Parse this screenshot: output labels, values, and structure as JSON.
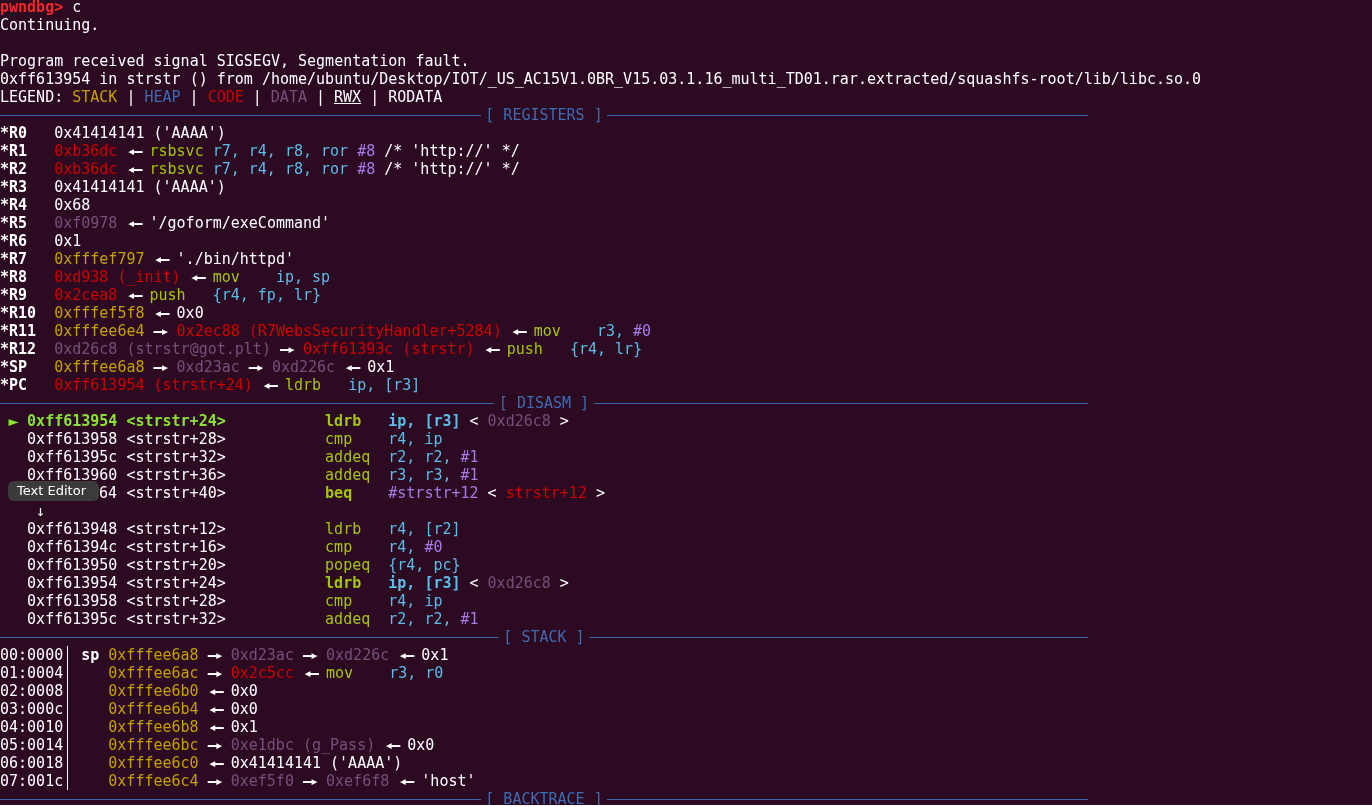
{
  "lines": [
    {
      "kind": "text",
      "segments": [
        {
          "text": "pwndbg>",
          "kind": "prompt"
        },
        {
          "text": "c",
          "kind": "plain"
        }
      ]
    },
    {
      "kind": "text",
      "segments": [
        {
          "text": "Continuing.",
          "kind": "plain"
        }
      ]
    },
    {
      "kind": "blank"
    },
    {
      "kind": "text",
      "segments": [
        {
          "text": "Program received signal SIGSEGV, Segmentation fault.",
          "kind": "plain"
        }
      ]
    },
    {
      "kind": "text",
      "segments": [
        {
          "text": "0xff613954 in strstr () from /home/ubuntu/Desktop/IOT/_US_AC15V1.0BR_V15.03.1.16_multi_TD01.rar.extracted/squashfs-root/lib/libc.so.0",
          "kind": "plain"
        }
      ]
    },
    {
      "kind": "text",
      "segments": [
        {
          "text": "LEGEND:",
          "kind": "plain"
        },
        {
          "text": "STACK",
          "kind": "stack"
        },
        {
          "text": "|",
          "kind": "plain"
        },
        {
          "text": "HEAP",
          "kind": "heap"
        },
        {
          "text": "|",
          "kind": "plain"
        },
        {
          "text": "CODE",
          "kind": "code"
        },
        {
          "text": "|",
          "kind": "plain"
        },
        {
          "text": "DATA",
          "kind": "data"
        },
        {
          "text": "|",
          "kind": "plain"
        },
        {
          "text": "RWX",
          "kind": "rwx"
        },
        {
          "text": "|",
          "kind": "plain"
        },
        {
          "text": "RODATA",
          "kind": "plain"
        }
      ]
    },
    {
      "kind": "rule",
      "title": "[ REGISTERS ]"
    },
    {
      "kind": "reg",
      "name": "*R0",
      "segments": [
        {
          "text": "0x41414141 ('AAAA')",
          "kind": "plain"
        }
      ]
    },
    {
      "kind": "reg",
      "name": "*R1",
      "segments": [
        {
          "text": "0xb36dc",
          "kind": "code"
        },
        {
          "text": "◂—",
          "kind": "arrow"
        },
        {
          "text": "rsbsvc",
          "kind": "insn"
        },
        {
          "text": "r7, r4, r8, ror",
          "kind": "reg"
        },
        {
          "text": "#8",
          "kind": "imm"
        },
        {
          "text": "/* 'http://' */",
          "kind": "plain"
        }
      ]
    },
    {
      "kind": "reg",
      "name": "*R2",
      "segments": [
        {
          "text": "0xb36dc",
          "kind": "code"
        },
        {
          "text": "◂—",
          "kind": "arrow"
        },
        {
          "text": "rsbsvc",
          "kind": "insn"
        },
        {
          "text": "r7, r4, r8, ror",
          "kind": "reg"
        },
        {
          "text": "#8",
          "kind": "imm"
        },
        {
          "text": "/* 'http://' */",
          "kind": "plain"
        }
      ]
    },
    {
      "kind": "reg",
      "name": "*R3",
      "segments": [
        {
          "text": "0x41414141 ('AAAA')",
          "kind": "plain"
        }
      ]
    },
    {
      "kind": "reg",
      "name": "*R4",
      "segments": [
        {
          "text": "0x68",
          "kind": "plain"
        }
      ]
    },
    {
      "kind": "reg",
      "name": "*R5",
      "segments": [
        {
          "text": "0xf0978",
          "kind": "data"
        },
        {
          "text": "◂—",
          "kind": "arrow"
        },
        {
          "text": "'/goform/exeCommand'",
          "kind": "plain"
        }
      ]
    },
    {
      "kind": "reg",
      "name": "*R6",
      "segments": [
        {
          "text": "0x1",
          "kind": "plain"
        }
      ]
    },
    {
      "kind": "reg",
      "name": "*R7",
      "segments": [
        {
          "text": "0xfffef797",
          "kind": "stack"
        },
        {
          "text": "◂—",
          "kind": "arrow"
        },
        {
          "text": "'./bin/httpd'",
          "kind": "plain"
        }
      ]
    },
    {
      "kind": "reg",
      "name": "*R8",
      "segments": [
        {
          "text": "0xd938 (_init)",
          "kind": "code"
        },
        {
          "text": "◂—",
          "kind": "arrow"
        },
        {
          "text": "mov",
          "kind": "insn"
        },
        {
          "text": "ip, sp",
          "kind": "reg"
        }
      ]
    },
    {
      "kind": "reg",
      "name": "*R9",
      "segments": [
        {
          "text": "0x2cea8",
          "kind": "code"
        },
        {
          "text": "◂—",
          "kind": "arrow"
        },
        {
          "text": "push",
          "kind": "insn"
        },
        {
          "text": "{r4, fp, lr}",
          "kind": "reg"
        }
      ]
    },
    {
      "kind": "reg",
      "name": "*R10",
      "segments": [
        {
          "text": "0xfffef5f8",
          "kind": "stack"
        },
        {
          "text": "◂—",
          "kind": "arrow"
        },
        {
          "text": "0x0",
          "kind": "plain"
        }
      ]
    },
    {
      "kind": "reg",
      "name": "*R11",
      "segments": [
        {
          "text": "0xfffee6e4",
          "kind": "stack"
        },
        {
          "text": "—▸",
          "kind": "arrow"
        },
        {
          "text": "0x2ec88 (R7WebsSecurityHandler+5284)",
          "kind": "code"
        },
        {
          "text": "◂—",
          "kind": "arrow"
        },
        {
          "text": "mov",
          "kind": "insn"
        },
        {
          "text": "r3,",
          "kind": "reg"
        },
        {
          "text": "#0",
          "kind": "imm"
        }
      ]
    },
    {
      "kind": "reg",
      "name": "*R12",
      "segments": [
        {
          "text": "0xd26c8 (strstr@got.plt)",
          "kind": "data"
        },
        {
          "text": "—▸",
          "kind": "arrow"
        },
        {
          "text": "0xff61393c (strstr)",
          "kind": "code"
        },
        {
          "text": "◂—",
          "kind": "arrow"
        },
        {
          "text": "push",
          "kind": "insn"
        },
        {
          "text": "{r4, lr}",
          "kind": "reg"
        }
      ]
    },
    {
      "kind": "reg",
      "name": "*SP",
      "segments": [
        {
          "text": "0xfffee6a8",
          "kind": "stack"
        },
        {
          "text": "—▸",
          "kind": "arrow"
        },
        {
          "text": "0xd23ac",
          "kind": "data"
        },
        {
          "text": "—▸",
          "kind": "arrow"
        },
        {
          "text": "0xd226c",
          "kind": "data"
        },
        {
          "text": "◂—",
          "kind": "arrow"
        },
        {
          "text": "0x1",
          "kind": "plain"
        }
      ]
    },
    {
      "kind": "reg",
      "name": "*PC",
      "segments": [
        {
          "text": "0xff613954 (strstr+24)",
          "kind": "code"
        },
        {
          "text": "◂—",
          "kind": "arrow"
        },
        {
          "text": "ldrb",
          "kind": "insn"
        },
        {
          "text": "ip, [r3]",
          "kind": "reg"
        }
      ]
    },
    {
      "kind": "rule",
      "title": "[ DISASM ]"
    },
    {
      "kind": "disasm",
      "current": true,
      "marker": "►",
      "address": "0xff613954",
      "symbol": "<strstr+24>",
      "mnemonic": "ldrb",
      "bold": true,
      "operands": [
        {
          "text": "ip, [r3]",
          "kind": "reg"
        },
        {
          "text": "<",
          "kind": "plain"
        },
        {
          "text": "0xd26c8",
          "kind": "data"
        },
        {
          "text": ">",
          "kind": "plain"
        }
      ]
    },
    {
      "kind": "disasm",
      "current": false,
      "address": "0xff613958",
      "symbol": "<strstr+28>",
      "mnemonic": "cmp",
      "bold": false,
      "operands": [
        {
          "text": "r4, ip",
          "kind": "reg"
        }
      ]
    },
    {
      "kind": "disasm",
      "current": false,
      "address": "0xff61395c",
      "symbol": "<strstr+32>",
      "mnemonic": "addeq",
      "bold": false,
      "operands": [
        {
          "text": "r2, r2,",
          "kind": "reg"
        },
        {
          "text": "#1",
          "kind": "imm"
        }
      ]
    },
    {
      "kind": "disasm",
      "current": false,
      "address": "0xff613960",
      "symbol": "<strstr+36>",
      "mnemonic": "addeq",
      "bold": false,
      "operands": [
        {
          "text": "r3, r3,",
          "kind": "reg"
        },
        {
          "text": "#1",
          "kind": "imm"
        }
      ]
    },
    {
      "kind": "disasm",
      "current": false,
      "tooltip": "Text Editor",
      "address": "64",
      "symbol": "<strstr+40>",
      "mnemonic": "beq",
      "bold": true,
      "operands": [
        {
          "text": "#strstr+12",
          "kind": "imm"
        },
        {
          "text": "<",
          "kind": "plain"
        },
        {
          "text": "strstr+12",
          "kind": "code"
        },
        {
          "text": ">",
          "kind": "plain"
        }
      ]
    },
    {
      "kind": "jump",
      "arrow": "↓"
    },
    {
      "kind": "disasm",
      "current": false,
      "address": "0xff613948",
      "symbol": "<strstr+12>",
      "mnemonic": "ldrb",
      "bold": false,
      "operands": [
        {
          "text": "r4, [r2]",
          "kind": "reg"
        }
      ]
    },
    {
      "kind": "disasm",
      "current": false,
      "address": "0xff61394c",
      "symbol": "<strstr+16>",
      "mnemonic": "cmp",
      "bold": false,
      "operands": [
        {
          "text": "r4,",
          "kind": "reg"
        },
        {
          "text": "#0",
          "kind": "imm"
        }
      ]
    },
    {
      "kind": "disasm",
      "current": false,
      "address": "0xff613950",
      "symbol": "<strstr+20>",
      "mnemonic": "popeq",
      "bold": false,
      "operands": [
        {
          "text": "{r4, pc}",
          "kind": "reg"
        }
      ]
    },
    {
      "kind": "disasm",
      "current": false,
      "address": "0xff613954",
      "symbol": "<strstr+24>",
      "mnemonic": "ldrb",
      "bold": true,
      "operands": [
        {
          "text": "ip, [r3]",
          "kind": "reg"
        },
        {
          "text": "<",
          "kind": "plain"
        },
        {
          "text": "0xd26c8",
          "kind": "data"
        },
        {
          "text": ">",
          "kind": "plain"
        }
      ]
    },
    {
      "kind": "disasm",
      "current": false,
      "address": "0xff613958",
      "symbol": "<strstr+28>",
      "mnemonic": "cmp",
      "bold": false,
      "operands": [
        {
          "text": "r4, ip",
          "kind": "reg"
        }
      ]
    },
    {
      "kind": "disasm",
      "current": false,
      "address": "0xff61395c",
      "symbol": "<strstr+32>",
      "mnemonic": "addeq",
      "bold": false,
      "operands": [
        {
          "text": "r2, r2,",
          "kind": "reg"
        },
        {
          "text": "#1",
          "kind": "imm"
        }
      ]
    },
    {
      "kind": "rule",
      "title": "[ STACK ]"
    },
    {
      "kind": "stack",
      "offset": "00:0000",
      "pointer": "sp",
      "segments": [
        {
          "text": "0xfffee6a8",
          "kind": "stack"
        },
        {
          "text": "—▸",
          "kind": "arrow"
        },
        {
          "text": "0xd23ac",
          "kind": "data"
        },
        {
          "text": "—▸",
          "kind": "arrow"
        },
        {
          "text": "0xd226c",
          "kind": "data"
        },
        {
          "text": "◂—",
          "kind": "arrow"
        },
        {
          "text": "0x1",
          "kind": "plain"
        }
      ]
    },
    {
      "kind": "stack",
      "offset": "01:0004",
      "segments": [
        {
          "text": "0xfffee6ac",
          "kind": "stack"
        },
        {
          "text": "—▸",
          "kind": "arrow"
        },
        {
          "text": "0x2c5cc",
          "kind": "code"
        },
        {
          "text": "◂—",
          "kind": "arrow"
        },
        {
          "text": "mov",
          "kind": "insn"
        },
        {
          "text": "r3, r0",
          "kind": "reg"
        }
      ]
    },
    {
      "kind": "stack",
      "offset": "02:0008",
      "segments": [
        {
          "text": "0xfffee6b0",
          "kind": "stack"
        },
        {
          "text": "◂—",
          "kind": "arrow"
        },
        {
          "text": "0x0",
          "kind": "plain"
        }
      ]
    },
    {
      "kind": "stack",
      "offset": "03:000c",
      "segments": [
        {
          "text": "0xfffee6b4",
          "kind": "stack"
        },
        {
          "text": "◂—",
          "kind": "arrow"
        },
        {
          "text": "0x0",
          "kind": "plain"
        }
      ]
    },
    {
      "kind": "stack",
      "offset": "04:0010",
      "segments": [
        {
          "text": "0xfffee6b8",
          "kind": "stack"
        },
        {
          "text": "◂—",
          "kind": "arrow"
        },
        {
          "text": "0x1",
          "kind": "plain"
        }
      ]
    },
    {
      "kind": "stack",
      "offset": "05:0014",
      "segments": [
        {
          "text": "0xfffee6bc",
          "kind": "stack"
        },
        {
          "text": "—▸",
          "kind": "arrow"
        },
        {
          "text": "0xe1dbc (g_Pass)",
          "kind": "data"
        },
        {
          "text": "◂—",
          "kind": "arrow"
        },
        {
          "text": "0x0",
          "kind": "plain"
        }
      ]
    },
    {
      "kind": "stack",
      "offset": "06:0018",
      "segments": [
        {
          "text": "0xfffee6c0",
          "kind": "stack"
        },
        {
          "text": "◂—",
          "kind": "arrow"
        },
        {
          "text": "0x41414141 ('AAAA')",
          "kind": "plain"
        }
      ]
    },
    {
      "kind": "stack",
      "offset": "07:001c",
      "segments": [
        {
          "text": "0xfffee6c4",
          "kind": "stack"
        },
        {
          "text": "—▸",
          "kind": "arrow"
        },
        {
          "text": "0xef5f0",
          "kind": "data"
        },
        {
          "text": "—▸",
          "kind": "arrow"
        },
        {
          "text": "0xef6f8",
          "kind": "data"
        },
        {
          "text": "◂—",
          "kind": "arrow"
        },
        {
          "text": "'host'",
          "kind": "plain"
        }
      ]
    },
    {
      "kind": "rule",
      "title": "[ BACKTRACE ]"
    }
  ]
}
